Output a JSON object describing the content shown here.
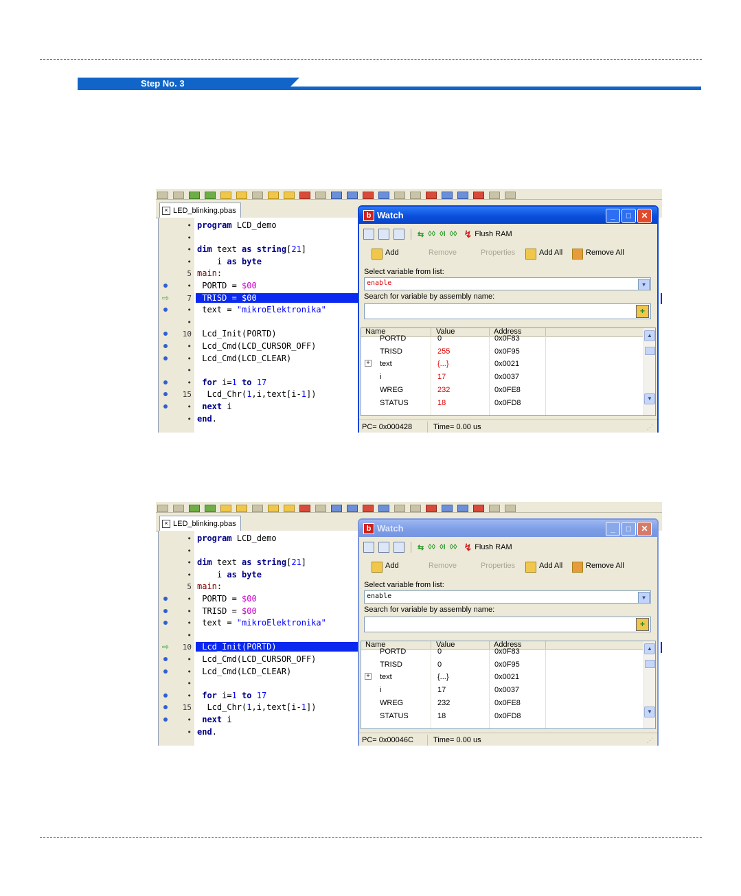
{
  "step_label": "Step No. 3",
  "panels": [
    {
      "tab_label": "LED_blinking.pbas",
      "code": [
        {
          "marker": "",
          "num": "•",
          "html": "<span class='kw'>program</span> LCD_demo"
        },
        {
          "marker": "",
          "num": "•",
          "html": ""
        },
        {
          "marker": "",
          "num": "•",
          "html": "<span class='kw'>dim</span> text <span class='kw'>as</span> <span class='kw'>string</span>[<span class='numc'>21</span>]"
        },
        {
          "marker": "",
          "num": "•",
          "html": "    i <span class='kw'>as</span> <span class='kw'>byte</span>"
        },
        {
          "marker": "",
          "num": "5",
          "html": "<span class='kw' style='color:#800000;font-weight:normal'>main</span>:"
        },
        {
          "marker": "dot",
          "num": "•",
          "html": " PORTD = <span class='hex'>$00</span>"
        },
        {
          "marker": "arrow",
          "num": "7",
          "html": " TRISD = $00",
          "active": true
        },
        {
          "marker": "dot",
          "num": "•",
          "html": " text = <span class='str'>\"mikroElektronika\"</span>"
        },
        {
          "marker": "",
          "num": "•",
          "html": ""
        },
        {
          "marker": "dot",
          "num": "10",
          "html": " Lcd_Init(PORTD)"
        },
        {
          "marker": "dot",
          "num": "•",
          "html": " Lcd_Cmd(LCD_CURSOR_OFF)"
        },
        {
          "marker": "dot",
          "num": "•",
          "html": " Lcd_Cmd(LCD_CLEAR)"
        },
        {
          "marker": "",
          "num": "•",
          "html": ""
        },
        {
          "marker": "dot",
          "num": "•",
          "html": " <span class='kw'>for</span> i=<span class='numc'>1</span> <span class='kw'>to</span> <span class='numc'>17</span>"
        },
        {
          "marker": "dot",
          "num": "15",
          "html": "  Lcd_Chr(<span class='numc'>1</span>,i,text[i-<span class='numc'>1</span>])"
        },
        {
          "marker": "dot",
          "num": "•",
          "html": " <span class='kw'>next</span> i"
        },
        {
          "marker": "",
          "num": "•",
          "html": "<span class='kw'>end</span>."
        }
      ],
      "watch": {
        "title": "Watch",
        "active": true,
        "flush_label": "Flush RAM",
        "add_label": "Add",
        "remove_label": "Remove",
        "properties_label": "Properties",
        "add_all_label": "Add All",
        "remove_all_label": "Remove All",
        "select_label": "Select variable from list:",
        "select_value": "enable",
        "select_value_red": true,
        "search_label": "Search for variable by assembly name:",
        "columns": [
          "Name",
          "Value",
          "Address"
        ],
        "rows": [
          {
            "name": "PORTD",
            "value": "0",
            "address": "0x0F83",
            "red": false,
            "expand": false
          },
          {
            "name": "TRISD",
            "value": "255",
            "address": "0x0F95",
            "red": true,
            "expand": false
          },
          {
            "name": "text",
            "value": "{...}",
            "address": "0x0021",
            "red": true,
            "expand": true
          },
          {
            "name": "i",
            "value": "17",
            "address": "0x0037",
            "red": true,
            "expand": false
          },
          {
            "name": "WREG",
            "value": "232",
            "address": "0x0FE8",
            "red": true,
            "expand": false
          },
          {
            "name": "STATUS",
            "value": "18",
            "address": "0x0FD8",
            "red": true,
            "expand": false
          }
        ],
        "pc": "PC= 0x000428",
        "time": "Time= 0.00 us"
      }
    },
    {
      "tab_label": "LED_blinking.pbas",
      "code": [
        {
          "marker": "",
          "num": "•",
          "html": "<span class='kw'>program</span> LCD_demo"
        },
        {
          "marker": "",
          "num": "•",
          "html": ""
        },
        {
          "marker": "",
          "num": "•",
          "html": "<span class='kw'>dim</span> text <span class='kw'>as</span> <span class='kw'>string</span>[<span class='numc'>21</span>]"
        },
        {
          "marker": "",
          "num": "•",
          "html": "    i <span class='kw'>as</span> <span class='kw'>byte</span>"
        },
        {
          "marker": "",
          "num": "5",
          "html": "<span class='kw' style='color:#800000;font-weight:normal'>main</span>:"
        },
        {
          "marker": "dot",
          "num": "•",
          "html": " PORTD = <span class='hex'>$00</span>"
        },
        {
          "marker": "dot",
          "num": "•",
          "html": " TRISD = <span class='hex'>$00</span>"
        },
        {
          "marker": "dot",
          "num": "•",
          "html": " text = <span class='str'>\"mikroElektronika\"</span>"
        },
        {
          "marker": "",
          "num": "•",
          "html": ""
        },
        {
          "marker": "arrow",
          "num": "10",
          "html": " Lcd_Init(PORTD)",
          "active": true
        },
        {
          "marker": "dot",
          "num": "•",
          "html": " Lcd_Cmd(LCD_CURSOR_OFF)"
        },
        {
          "marker": "dot",
          "num": "•",
          "html": " Lcd_Cmd(LCD_CLEAR)"
        },
        {
          "marker": "",
          "num": "•",
          "html": ""
        },
        {
          "marker": "dot",
          "num": "•",
          "html": " <span class='kw'>for</span> i=<span class='numc'>1</span> <span class='kw'>to</span> <span class='numc'>17</span>"
        },
        {
          "marker": "dot",
          "num": "15",
          "html": "  Lcd_Chr(<span class='numc'>1</span>,i,text[i-<span class='numc'>1</span>])"
        },
        {
          "marker": "dot",
          "num": "•",
          "html": " <span class='kw'>next</span> i"
        },
        {
          "marker": "",
          "num": "•",
          "html": "<span class='kw'>end</span>."
        }
      ],
      "watch": {
        "title": "Watch",
        "active": false,
        "flush_label": "Flush RAM",
        "add_label": "Add",
        "remove_label": "Remove",
        "properties_label": "Properties",
        "add_all_label": "Add All",
        "remove_all_label": "Remove All",
        "select_label": "Select variable from list:",
        "select_value": "enable",
        "select_value_red": false,
        "search_label": "Search for variable by assembly name:",
        "columns": [
          "Name",
          "Value",
          "Address"
        ],
        "rows": [
          {
            "name": "PORTD",
            "value": "0",
            "address": "0x0F83",
            "red": false,
            "expand": false
          },
          {
            "name": "TRISD",
            "value": "0",
            "address": "0x0F95",
            "red": false,
            "expand": false
          },
          {
            "name": "text",
            "value": "{...}",
            "address": "0x0021",
            "red": false,
            "expand": true
          },
          {
            "name": "i",
            "value": "17",
            "address": "0x0037",
            "red": false,
            "expand": false
          },
          {
            "name": "WREG",
            "value": "232",
            "address": "0x0FE8",
            "red": false,
            "expand": false
          },
          {
            "name": "STATUS",
            "value": "18",
            "address": "0x0FD8",
            "red": false,
            "expand": false
          }
        ],
        "pc": "PC= 0x00046C",
        "time": "Time= 0.00 us"
      }
    }
  ]
}
